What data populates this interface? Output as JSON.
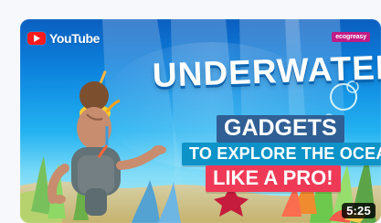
{
  "video": {
    "brand": "YouTube",
    "channel": "ecogreasy",
    "title_line_1": "UNDERWATER",
    "title_line_2": "GADGETS",
    "title_line_3": "TO EXPLORE THE OCEAN",
    "title_line_4": "LIKE A PRO!",
    "duration": "5:25"
  },
  "icons": {
    "brand": "youtube-icon"
  },
  "colors": {
    "title_blue": "#2f5f94",
    "title_cyan": "#0d93c8",
    "title_red": "#ef3a57",
    "youtube_red": "#ff1b1b",
    "badge_pink": "#c11b86"
  }
}
